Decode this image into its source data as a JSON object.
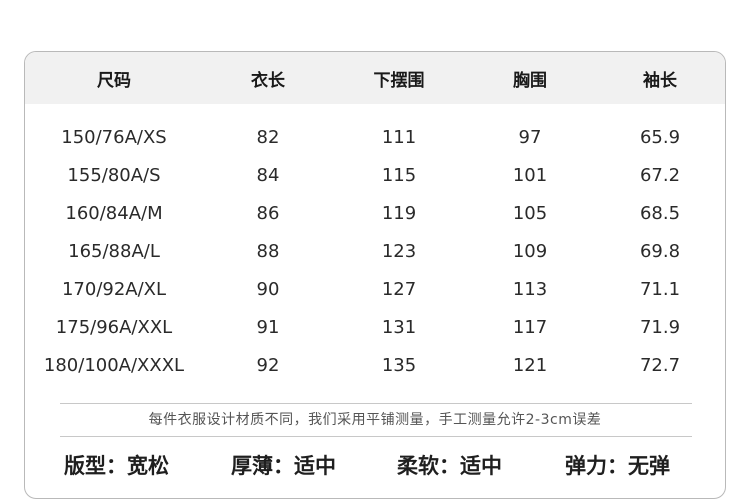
{
  "table": {
    "headers": [
      "尺码",
      "衣长",
      "下摆围",
      "胸围",
      "袖长"
    ],
    "rows": [
      [
        "150/76A/XS",
        "82",
        "111",
        "97",
        "65.9"
      ],
      [
        "155/80A/S",
        "84",
        "115",
        "101",
        "67.2"
      ],
      [
        "160/84A/M",
        "86",
        "119",
        "105",
        "68.5"
      ],
      [
        "165/88A/L",
        "88",
        "123",
        "109",
        "69.8"
      ],
      [
        "170/92A/XL",
        "90",
        "127",
        "113",
        "71.1"
      ],
      [
        "175/96A/XXL",
        "91",
        "131",
        "117",
        "71.9"
      ],
      [
        "180/100A/XXXL",
        "92",
        "135",
        "121",
        "72.7"
      ]
    ]
  },
  "note": "每件衣服设计材质不同，我们采用平铺测量，手工测量允许2-3cm误差",
  "properties": [
    "版型：宽松",
    "厚薄：适中",
    "柔软：适中",
    "弹力：无弹"
  ]
}
